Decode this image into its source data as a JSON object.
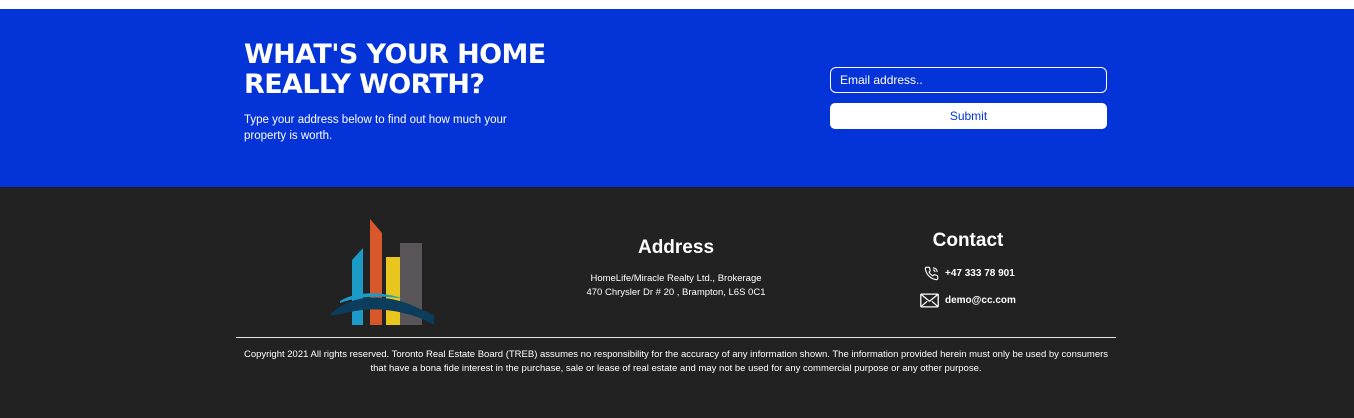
{
  "colors": {
    "cta_background": "#0433d8",
    "footer_background": "#222222",
    "text": "#ffffff"
  },
  "cta": {
    "title_line1": "WHAT'S YOUR HOME",
    "title_line2": "REALLY WORTH?",
    "subtitle": "Type your address below to find out how much your property is worth.",
    "email_placeholder": "Email address..",
    "submit_label": "Submit"
  },
  "footer": {
    "logo_icon": "building-wave-logo",
    "address": {
      "title": "Address",
      "line1": "HomeLife/Miracle Realty Ltd., Brokerage",
      "line2": "470 Chrysler Dr # 20 , Brampton, L6S 0C1"
    },
    "contact": {
      "title": "Contact",
      "phone_icon": "phone-icon",
      "phone": "+47 333 78 901",
      "email_icon": "envelope-icon",
      "email": "demo@cc.com"
    },
    "copyright": "Copyright 2021 All rights reserved. Toronto Real Estate Board (TREB) assumes no responsibility for the accuracy of any information shown. The information provided herein must only be used by consumers that have a bona fide interest in the purchase, sale or lease of real estate and may not be used for any commercial purpose or any other purpose."
  }
}
